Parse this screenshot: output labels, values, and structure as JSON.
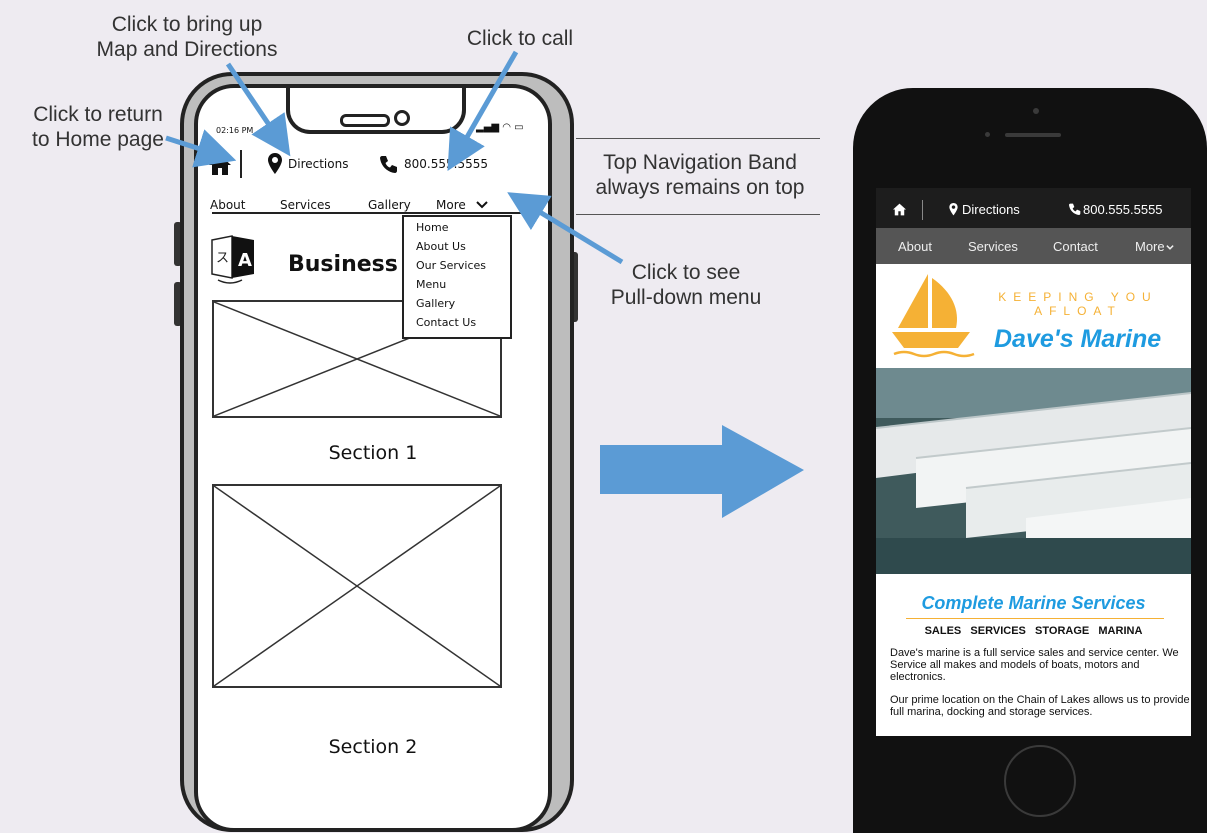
{
  "annotations": {
    "map": [
      "Click to bring up",
      "Map and Directions"
    ],
    "call": "Click to call",
    "home": [
      "Click to return",
      "to Home page"
    ],
    "topband": [
      "Top Navigation Band",
      "always remains on top"
    ],
    "menu": [
      "Click to see",
      "Pull-down menu"
    ]
  },
  "wireframe": {
    "status_time": "02:16 PM",
    "directions_label": "Directions",
    "phone": "800.555.5555",
    "nav": [
      "About",
      "Services",
      "Gallery",
      "More"
    ],
    "menu_items": [
      "Home",
      "About Us",
      "Our Services",
      "Menu",
      "Gallery",
      "Contact Us"
    ],
    "business_title": "Business",
    "section1": "Section 1",
    "section2": "Section 2"
  },
  "site": {
    "directions_label": "Directions",
    "phone": "800.555.5555",
    "nav": [
      "About",
      "Services",
      "Contact",
      "More"
    ],
    "tagline": "KEEPING YOU AFLOAT",
    "brand": "Dave's Marine",
    "heading": "Complete Marine Services",
    "services": "SALES   SERVICES   STORAGE   MARINA",
    "para1": "Dave's marine is a full service sales and service center. We Service all makes and models of boats, motors and electronics.",
    "para2": "Our prime location on the Chain of Lakes allows us to provide full marina, docking and storage services."
  },
  "colors": {
    "arrow": "#5b9bd5",
    "brand_blue": "#1e9be0",
    "logo_orange": "#f5b135"
  },
  "icons": [
    "home-icon",
    "map-pin-icon",
    "phone-icon",
    "chevron-down-icon",
    "translate-icon"
  ]
}
